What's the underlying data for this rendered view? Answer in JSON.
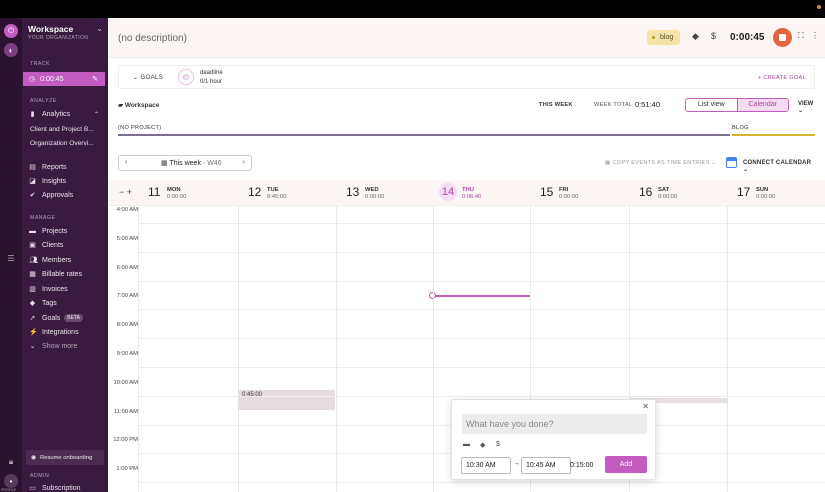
{
  "workspace": {
    "name": "Workspace",
    "subtitle": "YOUR ORGANIZATION"
  },
  "sidebar": {
    "track_section": "TRACK",
    "track_timer": "0:00:45",
    "analyze_section": "ANALYZE",
    "analytics_label": "Analytics",
    "analytics_sub": [
      "Client and Project B...",
      "Organization Overvi..."
    ],
    "analyze_items": [
      "Reports",
      "Insights",
      "Approvals"
    ],
    "manage_section": "MANAGE",
    "manage_items": [
      "Projects",
      "Clients",
      "Members",
      "Billable rates",
      "Invoices",
      "Tags",
      "Goals",
      "Integrations"
    ],
    "goals_badge": "BETA",
    "show_more": "Show more",
    "resume_onboarding": "Resume onboarding",
    "admin_section": "ADMIN",
    "admin_item": "Subscription",
    "profile_label": "PROFILE"
  },
  "header": {
    "description": "(no description)",
    "tag": "blog",
    "currency_symbol": "$",
    "timer": "0:00:45"
  },
  "goals": {
    "label": "GOALS",
    "goal_name": "deadline",
    "goal_value": "0/1 hour",
    "create_label": "CREATE GOAL"
  },
  "week_summary": {
    "workspace": "Workspace",
    "this_week": "THIS WEEK",
    "week_total_label": "WEEK TOTAL",
    "week_total_value": "0:51:40",
    "view_list": "List view",
    "view_calendar": "Calendar",
    "view_menu": "VIEW"
  },
  "projects": {
    "left_label": "(NO PROJECT)",
    "right_label": "BLOG",
    "left_color": "#7b6f8c",
    "right_color": "#d4b52c"
  },
  "week_nav": {
    "label": "This week",
    "week_num": "W46",
    "copy_events": "COPY EVENTS AS TIME ENTRIES",
    "connect_calendar": "CONNECT CALENDAR"
  },
  "days": [
    {
      "num": "11",
      "name": "MON",
      "time": "0:00:00"
    },
    {
      "num": "12",
      "name": "TUE",
      "time": "0:45:00"
    },
    {
      "num": "13",
      "name": "WED",
      "time": "0:00:00"
    },
    {
      "num": "14",
      "name": "THU",
      "time": "0:06:40"
    },
    {
      "num": "15",
      "name": "FRI",
      "time": "0:00:00"
    },
    {
      "num": "16",
      "name": "SAT",
      "time": "0:00:00"
    },
    {
      "num": "17",
      "name": "SUN",
      "time": "0:00:00"
    }
  ],
  "hours": [
    "4:00 AM",
    "5:00 AM",
    "6:00 AM",
    "7:00 AM",
    "8:00 AM",
    "9:00 AM",
    "10:00 AM",
    "11:00 AM",
    "12:00 PM",
    "1:00 PM"
  ],
  "entry": {
    "duration": "0:45:00"
  },
  "popup": {
    "placeholder": "What have you done?",
    "start": "10:30 AM",
    "end": "10:45 AM",
    "duration": "0:15:00",
    "add_label": "Add"
  },
  "colors": {
    "accent": "#c35cc0",
    "sidebar": "#3a1a40",
    "stop": "#e06540"
  }
}
